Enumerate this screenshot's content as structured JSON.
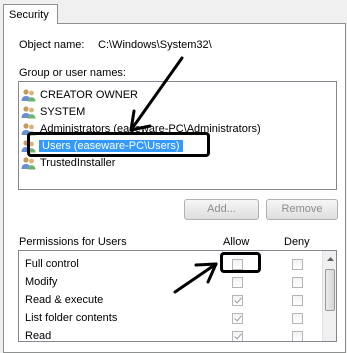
{
  "tab": {
    "label": "Security"
  },
  "object": {
    "label": "Object name:",
    "value": "C:\\Windows\\System32\\"
  },
  "group": {
    "label": "Group or user names:",
    "items": [
      {
        "label": "CREATOR OWNER"
      },
      {
        "label": "SYSTEM"
      },
      {
        "label": "Administrators (easeware-PC\\Administrators)"
      },
      {
        "label": "Users (easeware-PC\\Users)"
      },
      {
        "label": "TrustedInstaller"
      }
    ]
  },
  "buttons": {
    "add": "Add...",
    "remove": "Remove"
  },
  "permissions": {
    "title": "Permissions for Users",
    "allow_header": "Allow",
    "deny_header": "Deny",
    "rows": [
      {
        "label": "Full control",
        "allow": false,
        "deny": false
      },
      {
        "label": "Modify",
        "allow": false,
        "deny": false
      },
      {
        "label": "Read & execute",
        "allow": true,
        "deny": false
      },
      {
        "label": "List folder contents",
        "allow": true,
        "deny": false
      },
      {
        "label": "Read",
        "allow": true,
        "deny": false
      }
    ]
  },
  "colors": {
    "selection": "#3399ff",
    "annotation": "#000000"
  }
}
